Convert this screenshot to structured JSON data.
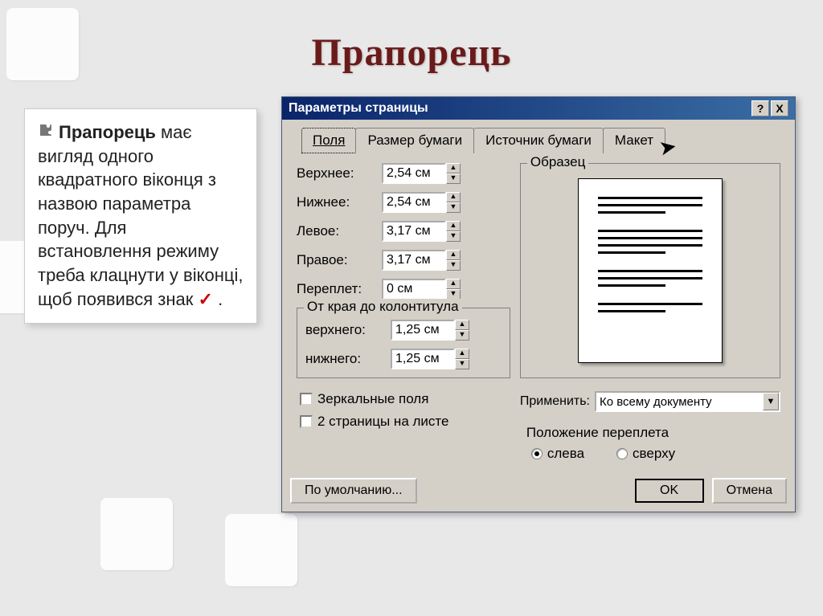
{
  "slide": {
    "title": "Прапорець",
    "body_bold": "Прапорець",
    "body_rest": " має вигляд одного квадратного віконця з назвою параметра поруч. Для встановлення режиму треба клацнути у віконці, щоб появився знак ",
    "check": "✓",
    "body_end": " ."
  },
  "dialog": {
    "title": "Параметры страницы",
    "tabs": [
      "Поля",
      "Размер бумаги",
      "Источник бумаги",
      "Макет"
    ],
    "fields": {
      "top": {
        "label": "Верхнее:",
        "value": "2,54 см"
      },
      "bottom": {
        "label": "Нижнее:",
        "value": "2,54 см"
      },
      "left": {
        "label": "Левое:",
        "value": "3,17 см"
      },
      "right": {
        "label": "Правое:",
        "value": "3,17 см"
      },
      "gutter": {
        "label": "Переплет:",
        "value": "0 см"
      }
    },
    "header_footer": {
      "legend": "От края до колонтитула",
      "header": {
        "label": "верхнего:",
        "value": "1,25 см"
      },
      "footer": {
        "label": "нижнего:",
        "value": "1,25 см"
      }
    },
    "checks": {
      "mirror": "Зеркальные поля",
      "two_pages": "2 страницы на листе"
    },
    "sample_legend": "Образец",
    "apply": {
      "label": "Применить:",
      "value": "Ко всему документу"
    },
    "bind": {
      "label": "Положение переплета",
      "left": "слева",
      "top": "сверху"
    },
    "buttons": {
      "default_btn": "По умолчанию...",
      "ok": "OK",
      "cancel": "Отмена"
    },
    "titlebar": {
      "help": "?",
      "close": "X"
    }
  }
}
